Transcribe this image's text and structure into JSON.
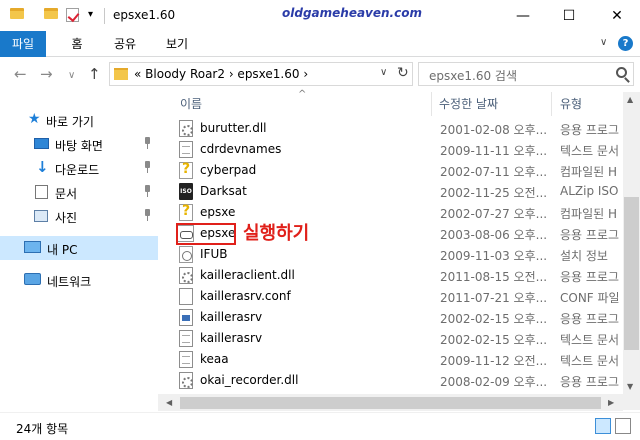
{
  "window": {
    "title": "epsxe1.60",
    "watermark": "oldgameheaven.com",
    "minimize_glyph": "—",
    "maximize_glyph": "☐",
    "close_glyph": "✕",
    "qat_dropdown_glyph": "▾"
  },
  "ribbon": {
    "tabs": [
      {
        "label": "파일",
        "active": true
      },
      {
        "label": "홈"
      },
      {
        "label": "공유"
      },
      {
        "label": "보기"
      }
    ],
    "expand_glyph": "∨",
    "help_glyph": "?"
  },
  "address": {
    "back_glyph": "←",
    "forward_glyph": "→",
    "recent_glyph": "∨",
    "up_glyph": "↑",
    "path": "«  Bloody Roar2  ›  epsxe1.60  ›",
    "dropdown_glyph": "∨",
    "refresh_glyph": "↻",
    "search_placeholder": "epsxe1.60 검색"
  },
  "sidebar": {
    "items": [
      {
        "label": "바로 가기",
        "icon": "star-icon"
      },
      {
        "label": "바탕 화면",
        "icon": "desktop-icon",
        "pinned": true
      },
      {
        "label": "다운로드",
        "icon": "download-icon",
        "pinned": true
      },
      {
        "label": "문서",
        "icon": "documents-icon",
        "pinned": true
      },
      {
        "label": "사진",
        "icon": "pictures-icon",
        "pinned": true
      },
      {
        "label": "내 PC",
        "icon": "pc-icon",
        "selected": true
      },
      {
        "label": "네트워크",
        "icon": "network-icon"
      }
    ]
  },
  "columns": {
    "name": "이름",
    "date": "수정한 날짜",
    "type": "유형",
    "sort_glyph": "^"
  },
  "files": [
    {
      "name": "burutter.dll",
      "date": "2001-02-08 오후...",
      "type": "응용 프로그",
      "icon": "gear-file-icon"
    },
    {
      "name": "cdrdevnames",
      "date": "2009-11-11 오후...",
      "type": "텍스트 문서",
      "icon": "text-file-icon"
    },
    {
      "name": "cyberpad",
      "date": "2002-07-11 오후...",
      "type": "컴파일된 H",
      "icon": "help-file-icon"
    },
    {
      "name": "Darksat",
      "date": "2002-11-25 오전...",
      "type": "ALZip ISO F",
      "icon": "iso-file-icon"
    },
    {
      "name": "epsxe",
      "date": "2002-07-27 오후...",
      "type": "컴파일된 H",
      "icon": "help-file-icon"
    },
    {
      "name": "epsxe",
      "date": "2003-08-06 오후...",
      "type": "응용 프로그",
      "icon": "gamepad-icon"
    },
    {
      "name": "IFUB",
      "date": "2009-11-03 오후...",
      "type": "설치 정보",
      "icon": "install-file-icon"
    },
    {
      "name": "kailleraclient.dll",
      "date": "2011-08-15 오전...",
      "type": "응용 프로그",
      "icon": "gear-file-icon"
    },
    {
      "name": "kaillerasrv.conf",
      "date": "2011-07-21 오후...",
      "type": "CONF 파일",
      "icon": "blank-file-icon"
    },
    {
      "name": "kaillerasrv",
      "date": "2002-02-15 오후...",
      "type": "응용 프로그",
      "icon": "exe-file-icon"
    },
    {
      "name": "kaillerasrv",
      "date": "2002-02-15 오후...",
      "type": "텍스트 문서",
      "icon": "text-file-icon"
    },
    {
      "name": "keaa",
      "date": "2009-11-12 오전...",
      "type": "텍스트 문서",
      "icon": "text-file-icon"
    },
    {
      "name": "okai_recorder.dll",
      "date": "2008-02-09 오후...",
      "type": "응용 프로그",
      "icon": "gear-file-icon"
    }
  ],
  "annotation": {
    "label": "실행하기",
    "color": "#e0201a"
  },
  "status": {
    "item_count": "24개 항목"
  },
  "colors": {
    "accent": "#1979ca",
    "selection": "#cce8ff"
  }
}
